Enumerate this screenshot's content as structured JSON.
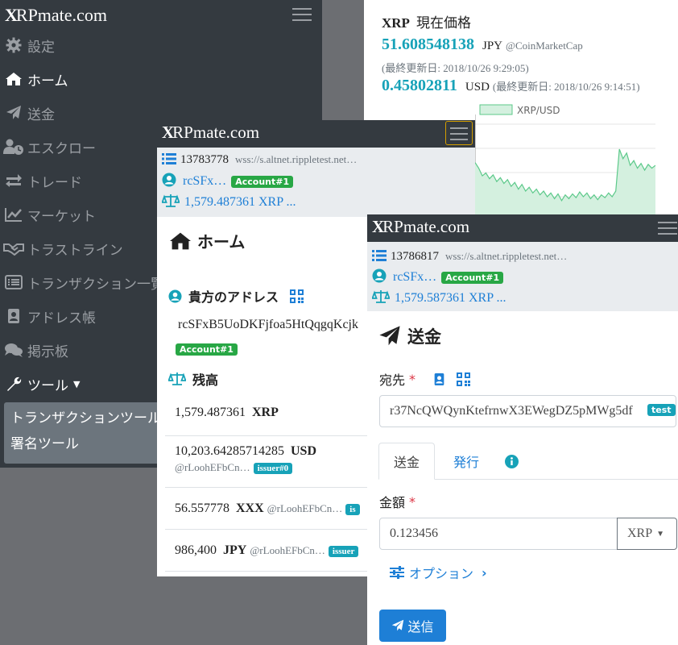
{
  "brand": {
    "logo_letter": "X",
    "name": "RPmate.com"
  },
  "sidebar": {
    "items": [
      {
        "label": "設定",
        "icon": "gear-icon"
      },
      {
        "label": "ホーム",
        "icon": "home-icon"
      },
      {
        "label": "送金",
        "icon": "paper-plane-icon"
      },
      {
        "label": "エスクロー",
        "icon": "user-clock-icon"
      },
      {
        "label": "トレード",
        "icon": "exchange-icon"
      },
      {
        "label": "マーケット",
        "icon": "chart-line-icon"
      },
      {
        "label": "トラストライン",
        "icon": "handshake-icon"
      },
      {
        "label": "トランザクション一覧",
        "icon": "list-alt-icon"
      },
      {
        "label": "アドレス帳",
        "icon": "address-book-icon"
      },
      {
        "label": "掲示板",
        "icon": "comments-icon"
      },
      {
        "label": "ツール",
        "icon": "wrench-icon"
      }
    ],
    "tools_menu": [
      "トランザクションツール",
      "署名ツール"
    ]
  },
  "price_card": {
    "coin": "XRP",
    "title": "現在価格",
    "jpy_price": "51.608548138",
    "jpy_unit": "JPY",
    "jpy_source": "@CoinMarketCap",
    "jpy_updated": "(最終更新日: 2018/10/26 9:29:05)",
    "usd_price": "0.45802811",
    "usd_unit": "USD",
    "usd_updated": "(最終更新日: 2018/10/26 9:14:51)"
  },
  "chart_data": {
    "type": "area",
    "series": [
      {
        "name": "XRP/USD",
        "values": [
          0.58,
          0.52,
          0.44,
          0.47,
          0.41,
          0.45,
          0.38,
          0.42,
          0.36,
          0.4,
          0.33,
          0.37,
          0.3,
          0.35,
          0.28,
          0.32,
          0.26,
          0.3,
          0.24,
          0.28,
          0.22,
          0.26,
          0.2,
          0.25,
          0.18,
          0.24,
          0.2,
          0.25,
          0.21,
          0.27,
          0.22,
          0.26,
          0.2,
          0.24,
          0.19,
          0.24,
          0.21,
          0.26,
          0.22,
          0.28,
          0.72,
          0.62,
          0.68,
          0.55,
          0.6,
          0.52,
          0.57,
          0.5,
          0.56,
          0.52,
          0.55
        ]
      }
    ],
    "grid": true,
    "legend": "top"
  },
  "home_panel": {
    "ledger": "13783778",
    "server": "wss://s.altnet.rippletest.net…",
    "account": "rcSFx…",
    "account_badge": "Account#1",
    "balance": "1,579.487361 XRP ...",
    "title": "ホーム",
    "address_heading": "貴方のアドレス",
    "address": "rcSFxB5UoDKFjfoa5HtQqgqKcjk",
    "address_badge": "Account#1",
    "balance_heading": "残高",
    "balances": [
      {
        "value": "1,579.487361",
        "currency": "XRP",
        "issuer": "",
        "badge": ""
      },
      {
        "value": "10,203.64285714285",
        "currency": "USD",
        "issuer": "@rLoohEFbCn…",
        "badge": "issuer#0"
      },
      {
        "value": "56.557778",
        "currency": "XXX",
        "issuer": "@rLoohEFbCn…",
        "badge": "is"
      },
      {
        "value": "986,400",
        "currency": "JPY",
        "issuer": "@rLoohEFbCn…",
        "badge": "issuer"
      }
    ]
  },
  "send_panel": {
    "ledger": "13786817",
    "server": "wss://s.altnet.rippletest.net…",
    "account": "rcSFx…",
    "account_badge": "Account#1",
    "balance": "1,579.587361 XRP ...",
    "title": "送金",
    "dest_label": "宛先",
    "required_mark": "*",
    "dest_value": "r37NcQWQynKtefrnwX3EWegDZ5pMWg5df",
    "dest_badge": "test",
    "tabs": [
      "送金",
      "発行"
    ],
    "amount_label": "金額",
    "amount_value": "0.123456",
    "currency": "XRP",
    "options_label": "オプション",
    "send_button": "送信"
  },
  "colors": {
    "navbar": "#343a40",
    "accent_teal": "#17a2b8",
    "link_blue": "#1e7fd6",
    "badge_green": "#28a745",
    "chart_fill": "#d4f0df",
    "chart_line": "#5cc98a"
  }
}
